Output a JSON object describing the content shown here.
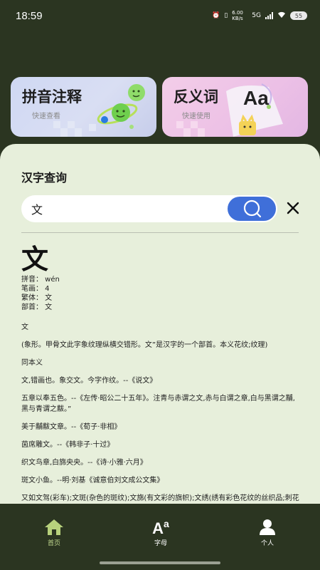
{
  "status_bar": {
    "time": "18:59",
    "network_speed": "6.00 KB/s",
    "network_type": "5G",
    "battery": "55"
  },
  "cards": [
    {
      "title": "拼音注释",
      "subtitle": "快速查看"
    },
    {
      "title": "反义词",
      "subtitle": "快速使用",
      "badge": "Aa"
    }
  ],
  "search": {
    "section_title": "汉字查询",
    "input_value": "文"
  },
  "result": {
    "character": "文",
    "pinyin": "拼音：  wén",
    "strokes": "笔画：  4",
    "traditional": "繁体：  文",
    "radical": "部首：  文",
    "definitions": [
      "文",
      "(象形。甲骨文此字象纹理纵横交错形。文”是汉字的一个部首。本义花纹;纹理)",
      "同本义",
      "文,错画也。象交文。今字作纹。--《说文》",
      "五章以奉五色。--《左传·昭公二十五年》。注青与赤谓之文,赤与白谓之章,白与黑谓之黼,黑与青谓之黻。”",
      "美于黼黻文章。--《荀子·非相》",
      "茵席雕文。--《韩非子·十过》",
      "织文鸟章,白旆央央。--《诗·小雅·六月》",
      "斑文小鱼。--明·刘基《诚意伯刘文成公文集》",
      "又如文驾(彩车);文斑(杂色的斑纹);文旆(有文彩的旗帜);文绣(绣有彩色花纹的丝织品;刺花图案);文织(有"
    ]
  },
  "bottom_nav": [
    {
      "label": "首页",
      "icon": "home-icon",
      "active": true
    },
    {
      "label": "字母",
      "icon": "letters-icon",
      "active": false
    },
    {
      "label": "个人",
      "icon": "person-icon",
      "active": false
    }
  ],
  "colors": {
    "background": "#2b3521",
    "panel": "#e7efdb",
    "search_button": "#3f6fd9",
    "active_tab": "#c2d98f"
  }
}
